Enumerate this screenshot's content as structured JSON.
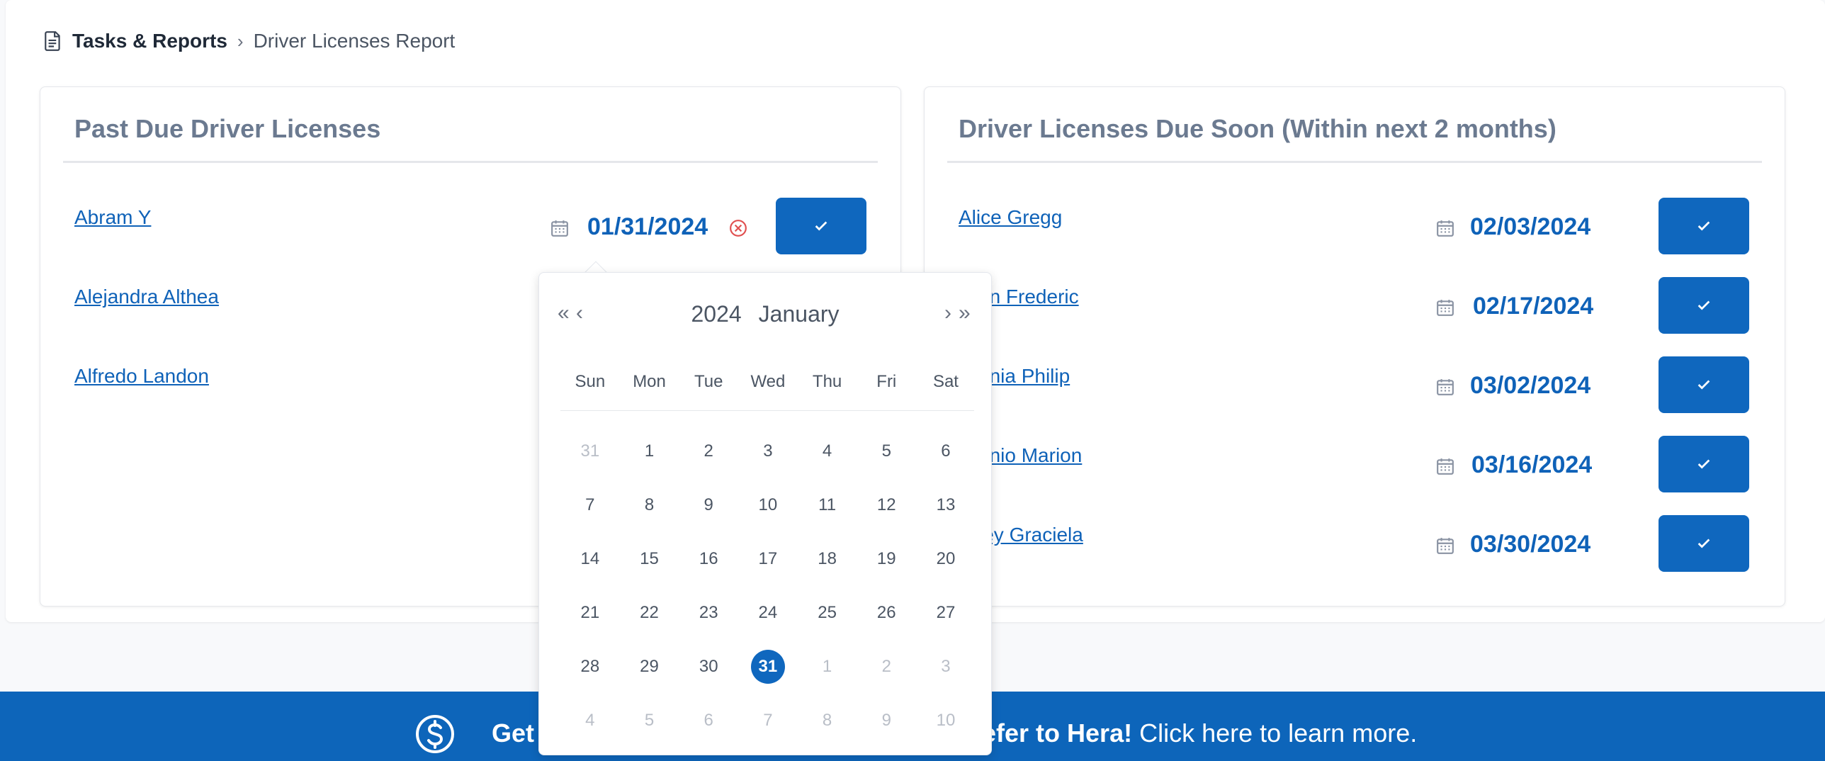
{
  "breadcrumb": {
    "root": "Tasks & Reports",
    "separator": "›",
    "current": "Driver Licenses Report"
  },
  "past_due": {
    "title": "Past Due Driver Licenses",
    "rows": [
      {
        "name": "Abram Y",
        "date": "01/31/2024"
      },
      {
        "name": "Alejandra Althea",
        "date": ""
      },
      {
        "name": "Alfredo Landon",
        "date": ""
      }
    ]
  },
  "due_soon": {
    "title": "Driver Licenses Due Soon (Within next 2 months)",
    "rows": [
      {
        "name": "Alice Gregg",
        "date": "02/03/2024"
      },
      {
        "name": "…on Frederic",
        "date": "02/17/2024"
      },
      {
        "name": "…onia Philip",
        "date": "03/02/2024"
      },
      {
        "name": "…onio Marion",
        "date": "03/16/2024"
      },
      {
        "name": "…ley Graciela",
        "date": "03/30/2024"
      }
    ]
  },
  "datepicker": {
    "year": "2024",
    "month": "January",
    "prev_year": "«",
    "prev_month": "‹",
    "next_month": "›",
    "next_year": "»",
    "weekdays": [
      "Sun",
      "Mon",
      "Tue",
      "Wed",
      "Thu",
      "Fri",
      "Sat"
    ],
    "weeks": [
      [
        "31",
        "1",
        "2",
        "3",
        "4",
        "5",
        "6"
      ],
      [
        "7",
        "8",
        "9",
        "10",
        "11",
        "12",
        "13"
      ],
      [
        "14",
        "15",
        "16",
        "17",
        "18",
        "19",
        "20"
      ],
      [
        "21",
        "22",
        "23",
        "24",
        "25",
        "26",
        "27"
      ],
      [
        "28",
        "29",
        "30",
        "31",
        "1",
        "2",
        "3"
      ],
      [
        "4",
        "5",
        "6",
        "7",
        "8",
        "9",
        "10"
      ]
    ],
    "selected_day": "31"
  },
  "banner": {
    "left": "Get",
    "bold": "efer to Hera!",
    "rest": " Click here to learn more."
  },
  "colors": {
    "primary": "#0f67be",
    "link": "#0f62b8",
    "banner": "#0d65ba",
    "title": "#6b7a90"
  }
}
